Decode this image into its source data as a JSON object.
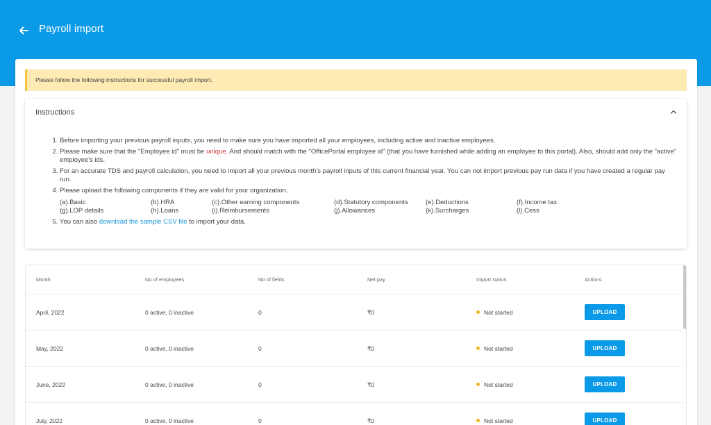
{
  "header": {
    "title": "Payroll import",
    "back_icon": "arrow-left-icon"
  },
  "colors": {
    "brand": "#0a9ae8",
    "notice_bg": "#fdebb3",
    "notice_border": "#f3c13a",
    "status_not_started": "#f0b51e",
    "link": "#1a95d6",
    "highlight_red": "#d23a3a"
  },
  "notice": {
    "text": "Please follow the following instructions for successful payroll import."
  },
  "instructions": {
    "title": "Instructions",
    "collapse_icon": "chevron-up-icon",
    "item1": "Before importing your previous payroll inputs, you need to make sure you have imported all your employees, including active and inactive employees.",
    "item2_prefix": "Please make sure that the \"Employee id\" must be ",
    "item2_highlight": "unique.",
    "item2_suffix": "  And should match with the \"OfficePortal employee id\" (that you have furnished while adding an employee to this portal). Also, should add only the \"active\" employee's ids.",
    "item3": "For an accurate TDS and payroll calculation, you need to import all your previous month's payroll inputs of this current financial year. You can not import previous pay run data if you have created a regular pay run.",
    "item4": "Please upload the following components if they are valid for your organization.",
    "components": [
      "(a).Basic",
      "(b).HRA",
      "(c).Other earning components",
      "(d).Statutory components",
      "(e).Deductions",
      "(f).Income tax",
      "(g).LOP details",
      "(h).Loans",
      "(i).Reimbursements",
      "(j).Allowances",
      "(k).Surcharges",
      "(l).Cess"
    ],
    "item5_prefix": "You can also ",
    "item5_link": "download the sample CSV file",
    "item5_suffix": " to import your data."
  },
  "table": {
    "columns": [
      "Month",
      "No of employees",
      "No of fields",
      "Net pay",
      "Import status",
      "Actions"
    ],
    "rows": [
      {
        "month": "April, 2022",
        "employees": "0 active, 0 inactive",
        "fields": "0",
        "net_pay": "₹0",
        "status": "Not started",
        "action": "UPLOAD"
      },
      {
        "month": "May, 2022",
        "employees": "0 active, 0 inactive",
        "fields": "0",
        "net_pay": "₹0",
        "status": "Not started",
        "action": "UPLOAD"
      },
      {
        "month": "June, 2022",
        "employees": "0 active, 0 inactive",
        "fields": "0",
        "net_pay": "₹0",
        "status": "Not started",
        "action": "UPLOAD"
      },
      {
        "month": "July, 2022",
        "employees": "0 active, 0 inactive",
        "fields": "0",
        "net_pay": "₹0",
        "status": "Not started",
        "action": "UPLOAD"
      }
    ]
  }
}
